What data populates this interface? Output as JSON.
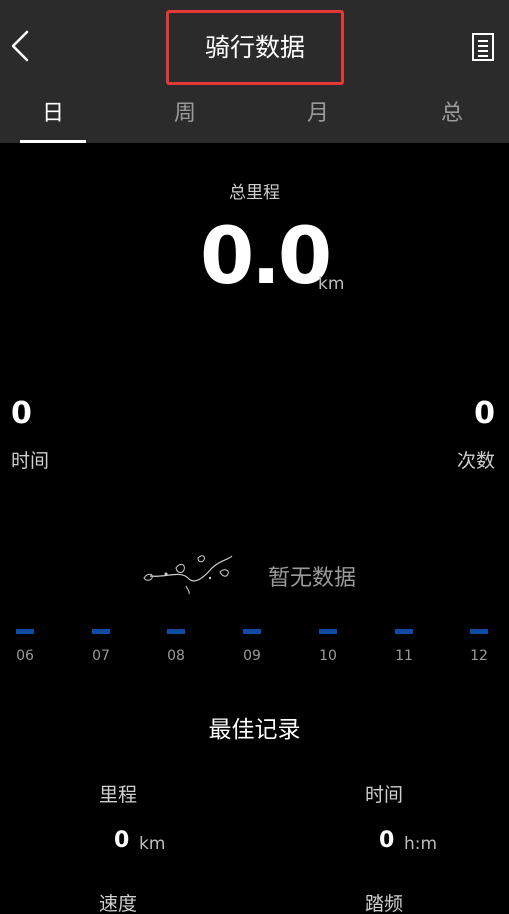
{
  "header": {
    "title": "骑行数据"
  },
  "tabs": [
    {
      "label": "日"
    },
    {
      "label": "周"
    },
    {
      "label": "月"
    },
    {
      "label": "总"
    }
  ],
  "summary": {
    "total_label": "总里程",
    "total_value": "0.0",
    "total_unit": "km",
    "time_value": "0",
    "time_label": "时间",
    "count_value": "0",
    "count_label": "次数"
  },
  "chart": {
    "empty_text": "暂无数据",
    "bar_color": "#0f4aa3",
    "hours": [
      "06",
      "07",
      "08",
      "09",
      "10",
      "11",
      "12"
    ]
  },
  "best": {
    "title": "最佳记录",
    "distance_label": "里程",
    "distance_value": "0",
    "distance_unit": "km",
    "time_label": "时间",
    "time_value": "0",
    "time_unit": "h:m",
    "speed_label": "速度",
    "cadence_label": "踏频"
  },
  "colors": {
    "accent_outline": "#e53935",
    "header_bg": "#2b2b2b",
    "background": "#000000"
  }
}
